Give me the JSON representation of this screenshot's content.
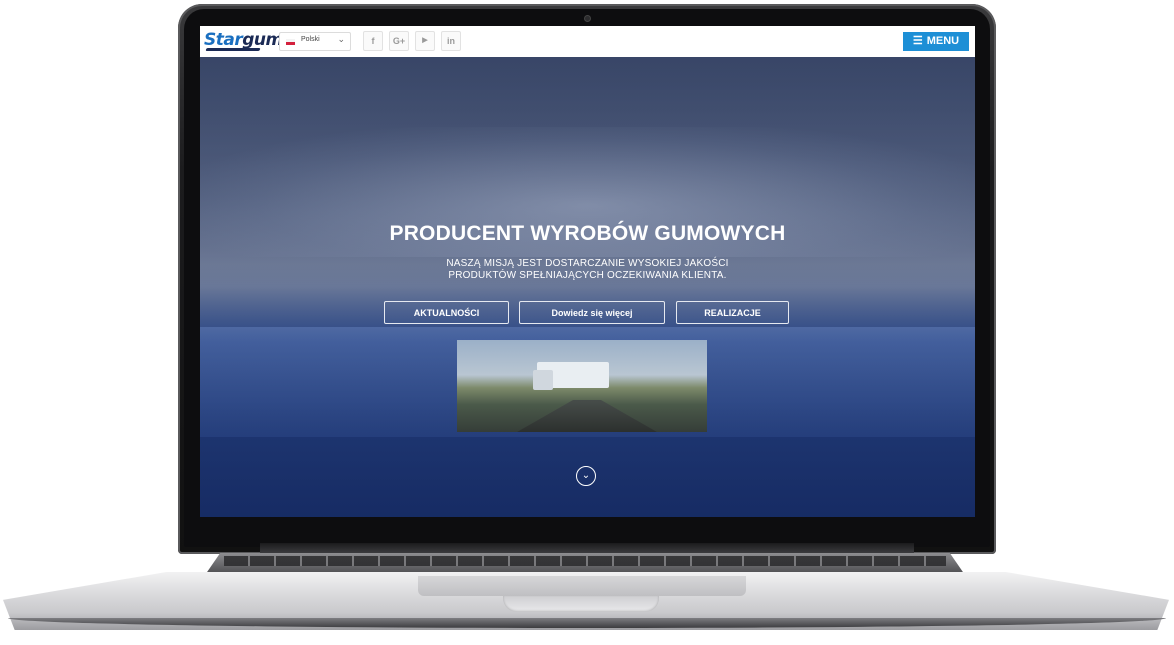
{
  "header": {
    "logo_text_a": "Star",
    "logo_text_b": "gum",
    "language": {
      "selected": "Polski",
      "flag_colors": [
        "#f4f4f4",
        "#d4213d"
      ]
    },
    "social_icons": [
      "facebook-icon",
      "google-plus-icon",
      "youtube-icon",
      "linkedin-icon"
    ],
    "social_glyphs": {
      "facebook": "f",
      "googleplus": "G+",
      "youtube": "▶",
      "linkedin": "in"
    },
    "menu_label": "MENU",
    "menu_color": "#1d8fd6"
  },
  "hero": {
    "title": "PRODUCENT WYROBÓW GUMOWYCH",
    "subtitle_line1": "NASZĄ MISJĄ JEST DOSTARCZANIE WYSOKIEJ JAKOŚCI",
    "subtitle_line2": "PRODUKTÓW SPEŁNIAJĄCYCH OCZEKIWANIA KLIENTA.",
    "buttons": [
      {
        "label": "AKTUALNOŚCI"
      },
      {
        "label": "Dowiedz się więcej"
      },
      {
        "label": "REALIZACJE"
      }
    ],
    "scroll_icon": "chevron-down-circle-icon"
  }
}
